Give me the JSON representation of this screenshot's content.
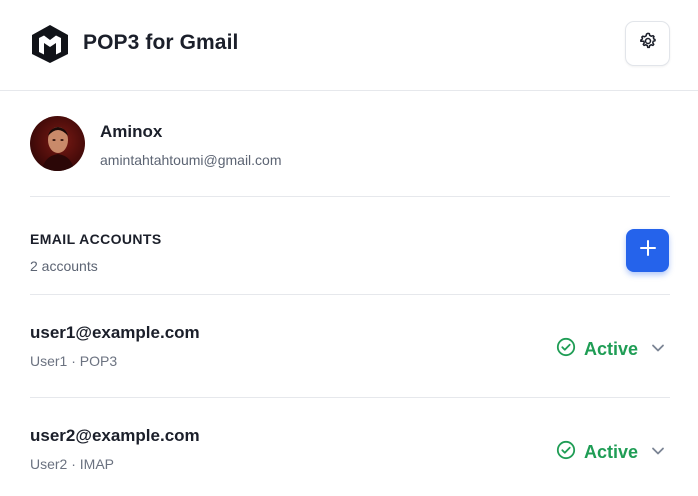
{
  "header": {
    "title": "POP3 for Gmail"
  },
  "profile": {
    "name": "Aminox",
    "email": "amintahtahtoumi@gmail.com"
  },
  "accounts_section": {
    "title": "EMAIL ACCOUNTS",
    "count_label": "2 accounts"
  },
  "accounts": [
    {
      "email": "user1@example.com",
      "meta": "User1 · POP3",
      "status": "Active"
    },
    {
      "email": "user2@example.com",
      "meta": "User2 · IMAP",
      "status": "Active"
    }
  ],
  "colors": {
    "accent": "#2563eb",
    "status_active": "#1f9d55",
    "text_primary": "#1b1f2a",
    "text_secondary": "#5c6473"
  }
}
